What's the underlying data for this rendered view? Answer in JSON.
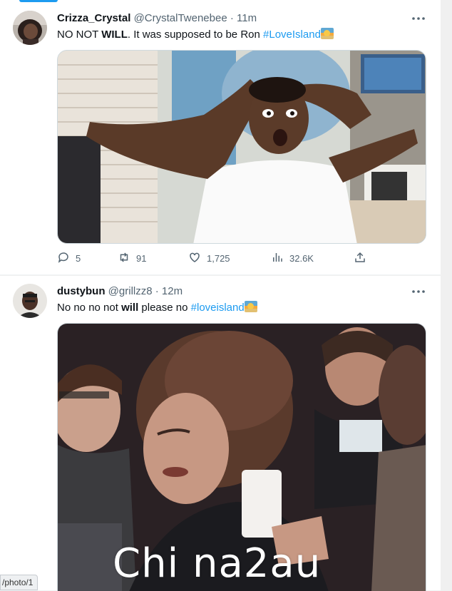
{
  "tweets": [
    {
      "display_name": "Crizza_Crystal",
      "handle": "@CrystalTwenebee",
      "separator": "·",
      "time": "11m",
      "text_pre": "NO NOT ",
      "text_bold": "WILL",
      "text_post": ". It was supposed to be Ron ",
      "hashtag": "#LoveIsland",
      "media_icon": "shocked-man-photo",
      "stats": {
        "replies": "5",
        "retweets": "91",
        "likes": "1,725",
        "views": "32.6K"
      }
    },
    {
      "display_name": "dustybun",
      "handle": "@grillzz8",
      "separator": "·",
      "time": "12m",
      "text_pre": "No no no not ",
      "text_bold": "will",
      "text_post": " please no ",
      "hashtag": "#loveisland",
      "media_icon": "woman-in-crowd-photo"
    }
  ],
  "icons": {
    "more": "more-icon",
    "reply": "reply-icon",
    "retweet": "retweet-icon",
    "like": "heart-icon",
    "views": "views-icon",
    "share": "share-icon",
    "flag_emoji": "island-emoji"
  },
  "colors": {
    "accent": "#1d9bf0",
    "secondary_text": "#536471",
    "primary_text": "#0f1419"
  },
  "url_fragment": "/photo/1",
  "watermark": "Chi na2au"
}
